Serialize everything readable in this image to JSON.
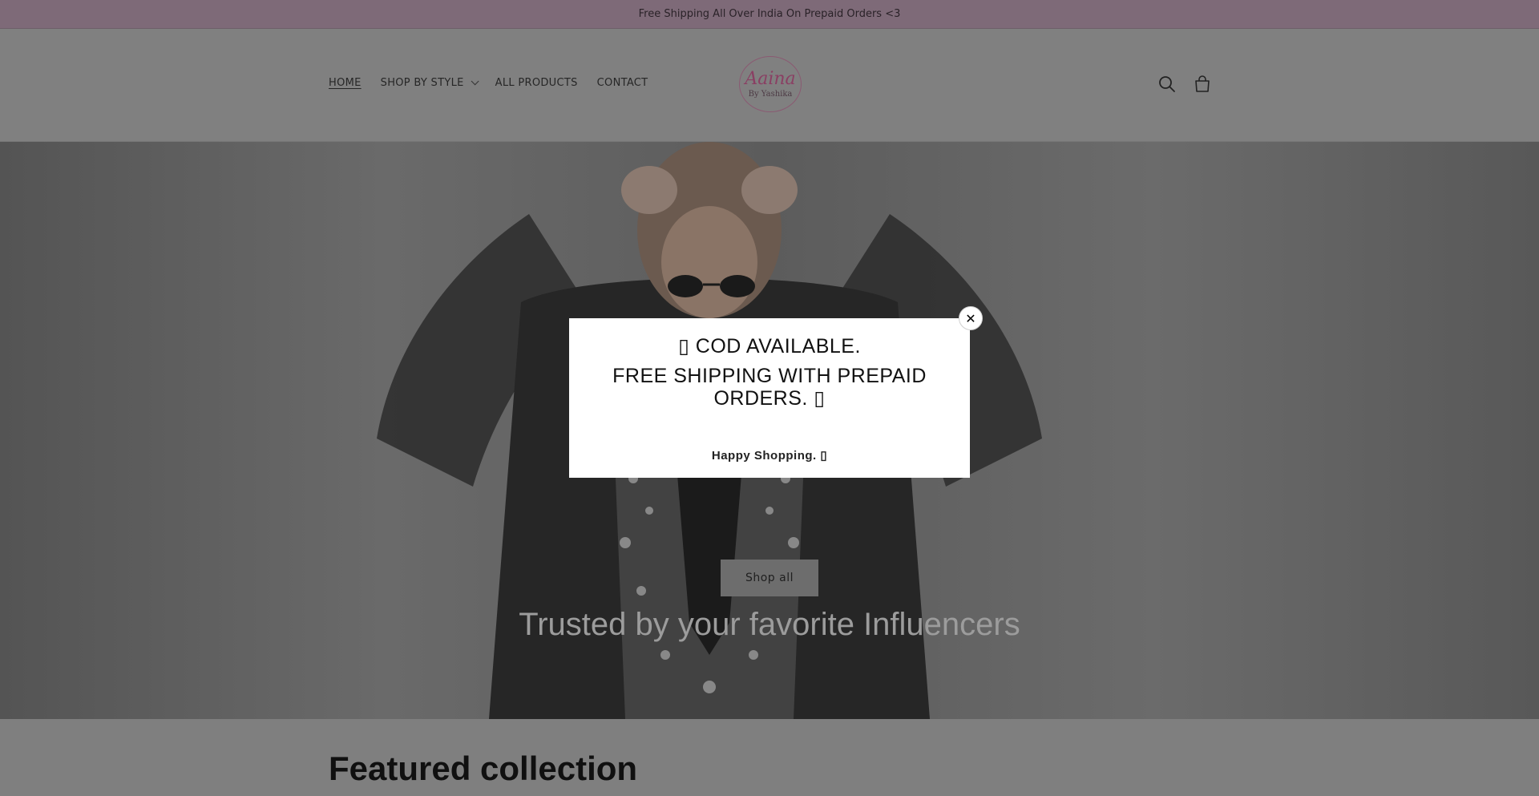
{
  "announcement": {
    "text": "Free Shipping All Over India On Prepaid Orders <3"
  },
  "nav": {
    "items": [
      {
        "label": "HOME"
      },
      {
        "label": "SHOP BY STYLE"
      },
      {
        "label": "ALL PRODUCTS"
      },
      {
        "label": "CONTACT"
      }
    ]
  },
  "logo": {
    "main": "Aaina",
    "sub": "By Yashika"
  },
  "header_icons": [
    "search-icon",
    "cart-icon"
  ],
  "hero": {
    "button_label": "Shop all",
    "caption": "Trusted by your favorite Influencers"
  },
  "featured": {
    "title": "Featured collection"
  },
  "popup": {
    "line1": "▯ COD AVAILABLE.",
    "line2": "FREE SHIPPING WITH PREPAID ORDERS. ▯",
    "line3": "Happy Shopping. ▯",
    "close_label": "✕"
  },
  "colors": {
    "announcement_bg": "#7e6a78",
    "header_bg": "#808080",
    "logo_accent": "#8a3f63",
    "popup_bg": "#ffffff"
  }
}
